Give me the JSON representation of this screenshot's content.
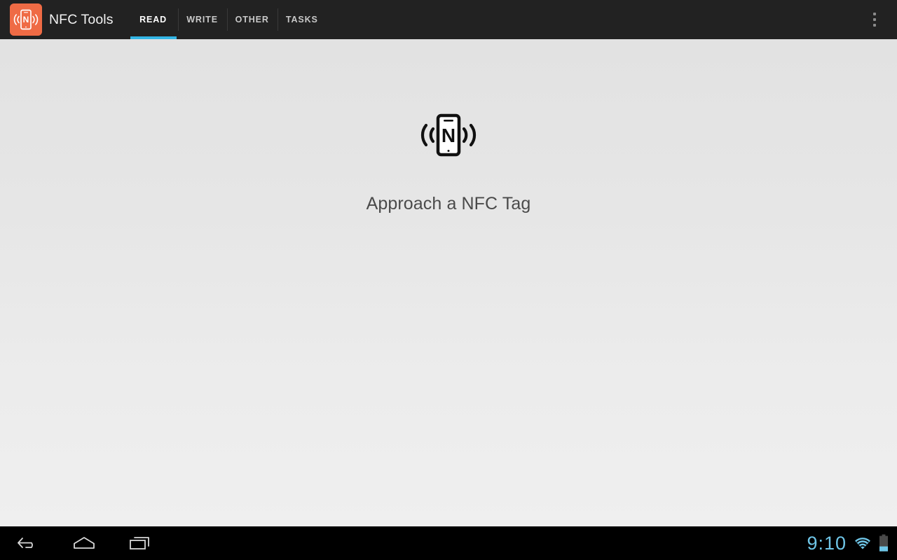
{
  "app": {
    "title": "NFC Tools",
    "icon_name": "nfc-app-icon",
    "accent_color": "#33b5e5",
    "brand_color": "#ef6b45",
    "actionbar_color": "#222222"
  },
  "actionbar": {
    "overflow_label": "More options",
    "tabs": [
      {
        "id": "read",
        "label": "READ",
        "selected": true
      },
      {
        "id": "write",
        "label": "WRITE",
        "selected": false
      },
      {
        "id": "other",
        "label": "OTHER",
        "selected": false
      },
      {
        "id": "tasks",
        "label": "TASKS",
        "selected": false
      }
    ]
  },
  "content": {
    "graphic_name": "nfc-tag-illustration",
    "prompt": "Approach a NFC Tag",
    "background_top": "#e2e2e2",
    "background_bottom": "#efefef"
  },
  "navbar": {
    "back_label": "Back",
    "home_label": "Home",
    "recents_label": "Recent apps",
    "clock": "9:10",
    "wifi_label": "Wi-Fi connected",
    "battery_label": "Battery low",
    "status_color": "#6fc6e8"
  }
}
